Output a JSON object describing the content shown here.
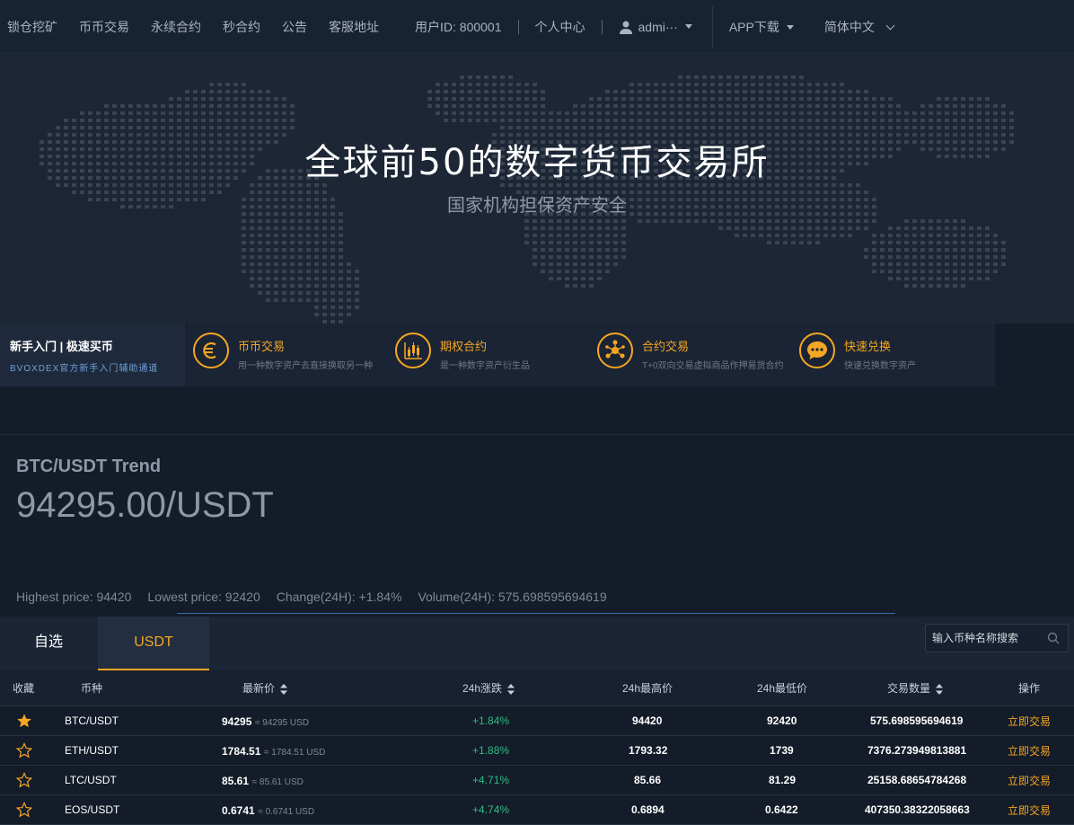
{
  "nav": {
    "items": [
      "锁仓挖矿",
      "币币交易",
      "永续合约",
      "秒合约",
      "公告",
      "客服地址"
    ],
    "user_id": "用户ID: 800001",
    "personal_center": "个人中心",
    "username": "admi···",
    "app_download": "APP下载",
    "language": "简体中文"
  },
  "banner": {
    "title": "全球前50的数字货币交易所",
    "subtitle": "国家机构担保资产安全"
  },
  "features": {
    "newbie_title": "新手入门 | 极速买币",
    "newbie_sub": "BVOXDEX官方新手入门辅助通道",
    "items": [
      {
        "title": "币币交易",
        "desc": "用一种数字资产去直接换取另一种",
        "icon": "euro-icon"
      },
      {
        "title": "期权合约",
        "desc": "是一种数字资产衍生品",
        "icon": "candlestick-icon"
      },
      {
        "title": "合约交易",
        "desc": "T+0双向交易虚拟商品作押易货合约",
        "icon": "network-icon"
      },
      {
        "title": "快速兑换",
        "desc": "快速兑换数字资产",
        "icon": "chat-icon"
      }
    ]
  },
  "trend": {
    "title": "BTC/USDT Trend",
    "price": "94295.00/USDT",
    "high": "Highest price: 94420",
    "low": "Lowest price: 92420",
    "change": "Change(24H): +1.84%",
    "volume": "Volume(24H): 575.698595694619"
  },
  "tabs": {
    "favorites": "自选",
    "usdt": "USDT",
    "search_placeholder": "输入币种名称搜索"
  },
  "table": {
    "headers": {
      "fav": "收藏",
      "pair": "币种",
      "last": "最新价",
      "change": "24h涨跌",
      "high": "24h最高价",
      "low": "24h最低价",
      "volume": "交易数量",
      "action": "操作"
    },
    "rows": [
      {
        "pair": "BTC/USDT",
        "price": "94295",
        "usd": "≈ 94295 USD",
        "change": "+1.84%",
        "high": "94420",
        "low": "92420",
        "volume": "575.698595694619",
        "action": "立即交易",
        "starred": true
      },
      {
        "pair": "ETH/USDT",
        "price": "1784.51",
        "usd": "≈ 1784.51 USD",
        "change": "+1.88%",
        "high": "1793.32",
        "low": "1739",
        "volume": "7376.273949813881",
        "action": "立即交易",
        "starred": false
      },
      {
        "pair": "LTC/USDT",
        "price": "85.61",
        "usd": "≈ 85.61 USD",
        "change": "+4.71%",
        "high": "85.66",
        "low": "81.29",
        "volume": "25158.68654784268",
        "action": "立即交易",
        "starred": false
      },
      {
        "pair": "EOS/USDT",
        "price": "0.6741",
        "usd": "≈ 0.6741 USD",
        "change": "+4.74%",
        "high": "0.6894",
        "low": "0.6422",
        "volume": "407350.38322058663",
        "action": "立即交易",
        "starred": false
      }
    ]
  },
  "colors": {
    "accent": "#f5a623",
    "up": "#2ebd85",
    "background": "#141c29"
  }
}
